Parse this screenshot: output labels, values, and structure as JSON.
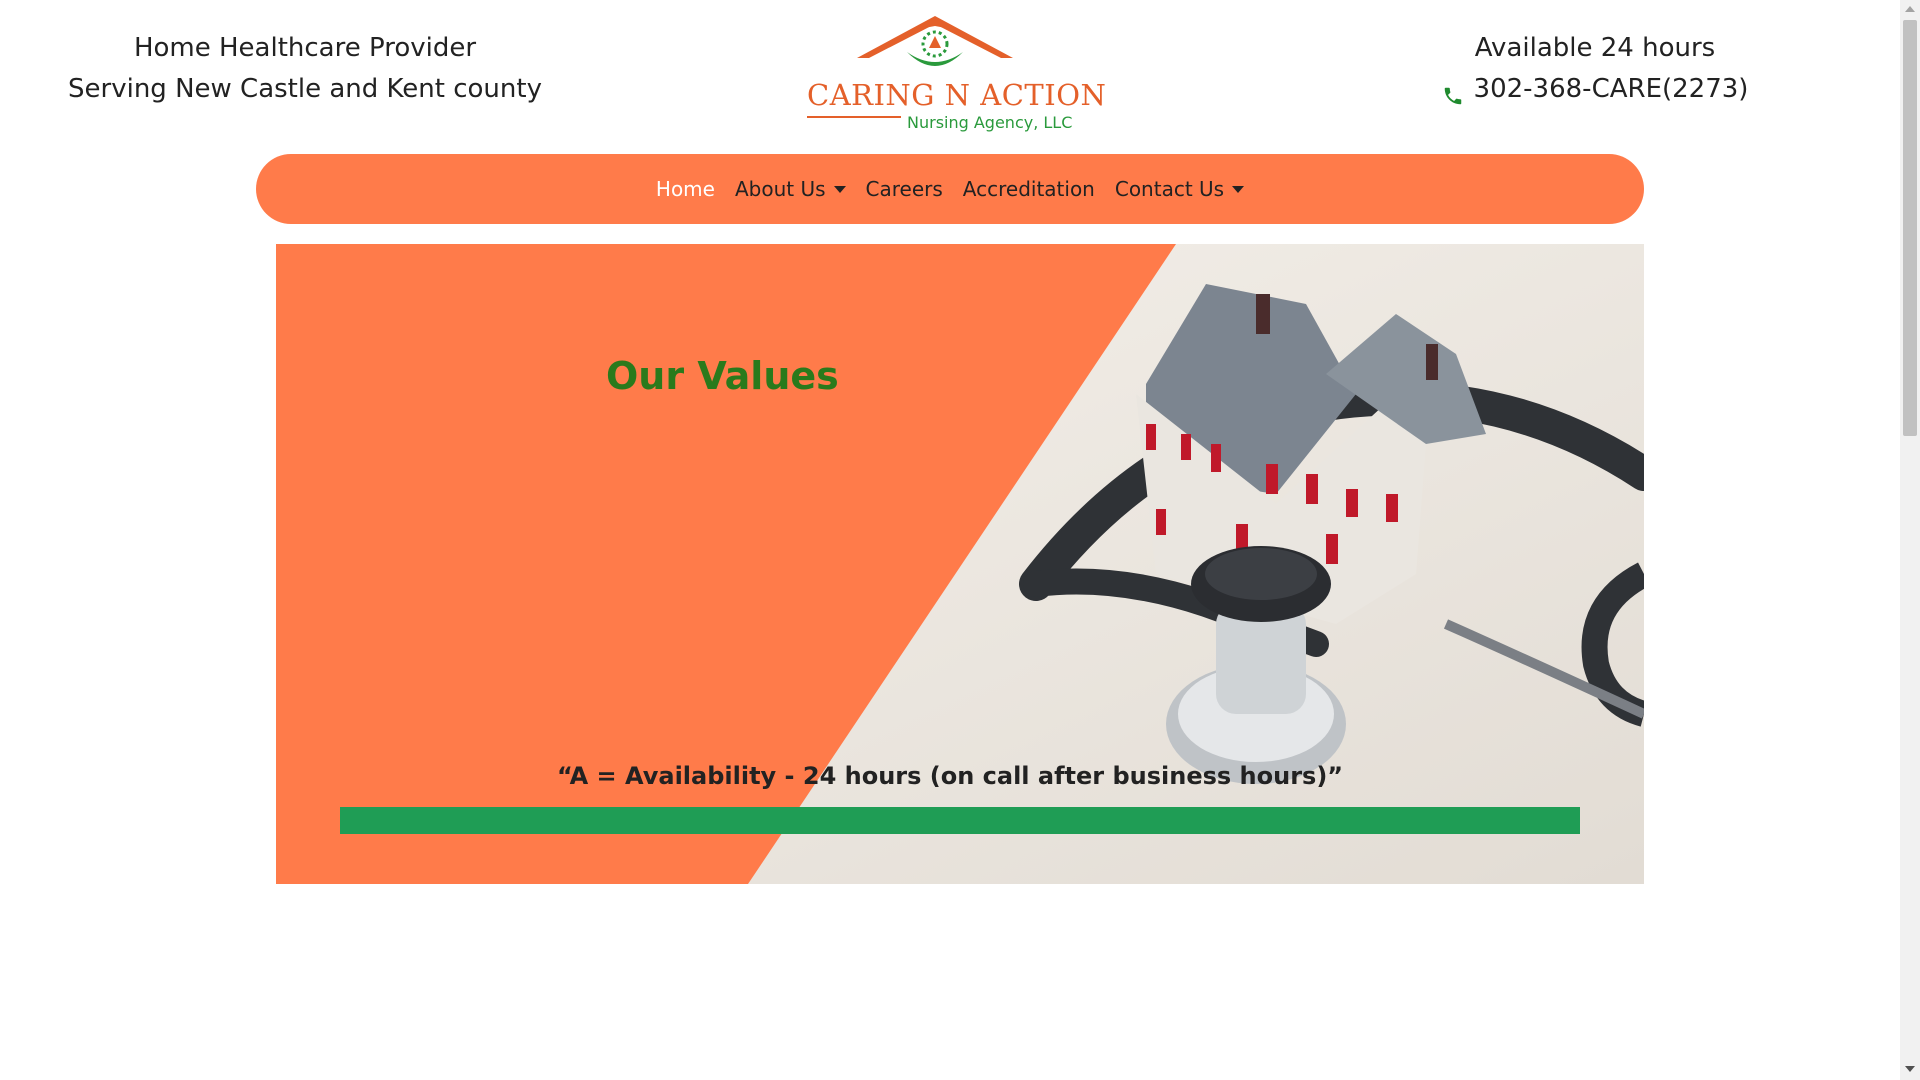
{
  "header": {
    "left_line1": "Home Healthcare Provider",
    "left_line2": "Serving New Castle and Kent county",
    "right_line1": "Available 24 hours",
    "phone": "302-368-CARE(2273)",
    "phone_icon": "phone-icon"
  },
  "logo": {
    "title": "CARING N ACTION",
    "subtitle": "Nursing Agency, LLC",
    "roof_color": "#e4602a",
    "accent_color": "#2a9a3c"
  },
  "nav": {
    "items": [
      {
        "label": "Home",
        "active": true,
        "dropdown": false
      },
      {
        "label": "About Us",
        "active": false,
        "dropdown": true
      },
      {
        "label": "Careers",
        "active": false,
        "dropdown": false
      },
      {
        "label": "Accreditation",
        "active": false,
        "dropdown": false
      },
      {
        "label": "Contact Us",
        "active": false,
        "dropdown": true
      }
    ],
    "background": "#ff7b4a"
  },
  "hero": {
    "title": "Our Values",
    "quote": "“A = Availability - 24 hours (on call after business hours)”",
    "panel_color": "#ff7b4a",
    "title_color": "#2a7a1c",
    "bar_color": "#1f9d55",
    "image": "house-and-stethoscope"
  }
}
